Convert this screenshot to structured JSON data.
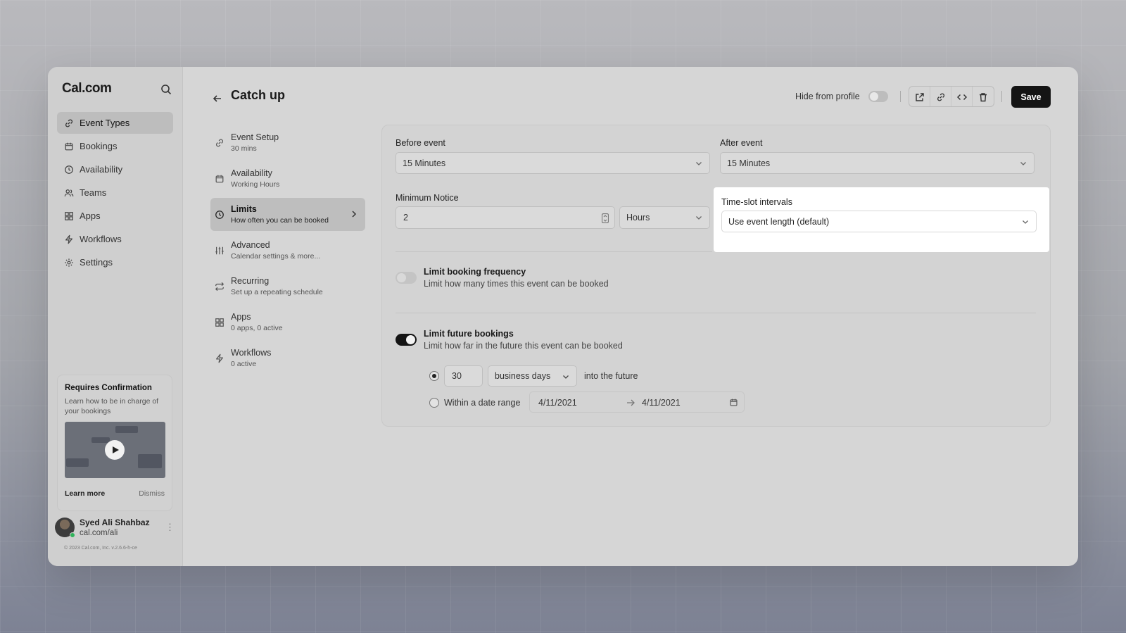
{
  "sidebar": {
    "logo": "Cal.com",
    "items": [
      {
        "label": "Event Types",
        "icon": "link-icon",
        "active": true
      },
      {
        "label": "Bookings",
        "icon": "calendar-icon"
      },
      {
        "label": "Availability",
        "icon": "clock-icon"
      },
      {
        "label": "Teams",
        "icon": "users-icon"
      },
      {
        "label": "Apps",
        "icon": "grid-icon"
      },
      {
        "label": "Workflows",
        "icon": "zap-icon"
      },
      {
        "label": "Settings",
        "icon": "gear-icon"
      }
    ],
    "card": {
      "title": "Requires Confirmation",
      "description": "Learn how to be in charge of your bookings",
      "learn_more": "Learn more",
      "dismiss": "Dismiss"
    },
    "profile": {
      "name": "Syed Ali Shahbaz",
      "url": "cal.com/ali"
    },
    "copyright": "© 2023 Cal.com, Inc. v.2.6.6-h-ce"
  },
  "header": {
    "title": "Catch up",
    "hide_from_profile": "Hide from profile",
    "save": "Save"
  },
  "subnav": [
    {
      "title": "Event Setup",
      "desc": "30 mins",
      "icon": "link-icon"
    },
    {
      "title": "Availability",
      "desc": "Working Hours",
      "icon": "calendar-icon"
    },
    {
      "title": "Limits",
      "desc": "How often you can be booked",
      "icon": "clock-icon",
      "active": true
    },
    {
      "title": "Advanced",
      "desc": "Calendar settings & more...",
      "icon": "sliders-icon"
    },
    {
      "title": "Recurring",
      "desc": "Set up a repeating schedule",
      "icon": "repeat-icon"
    },
    {
      "title": "Apps",
      "desc": "0 apps, 0 active",
      "icon": "grid-icon"
    },
    {
      "title": "Workflows",
      "desc": "0 active",
      "icon": "zap-icon"
    }
  ],
  "limits": {
    "before_event": {
      "label": "Before event",
      "value": "15 Minutes"
    },
    "after_event": {
      "label": "After event",
      "value": "15 Minutes"
    },
    "minimum_notice": {
      "label": "Minimum Notice",
      "value": "2",
      "unit": "Hours"
    },
    "time_slot": {
      "label": "Time-slot intervals",
      "value": "Use event length (default)"
    },
    "booking_frequency": {
      "title": "Limit booking frequency",
      "desc": "Limit how many times this event can be booked",
      "enabled": false
    },
    "future_bookings": {
      "title": "Limit future bookings",
      "desc": "Limit how far in the future this event can be booked",
      "enabled": true,
      "days_value": "30",
      "days_unit": "business days",
      "suffix": "into the future",
      "range_label": "Within a date range",
      "range_start": "4/11/2021",
      "range_end": "4/11/2021"
    }
  },
  "colors": {
    "primary": "#141414",
    "highlight": "#ffffff",
    "online": "#2fb35a"
  }
}
